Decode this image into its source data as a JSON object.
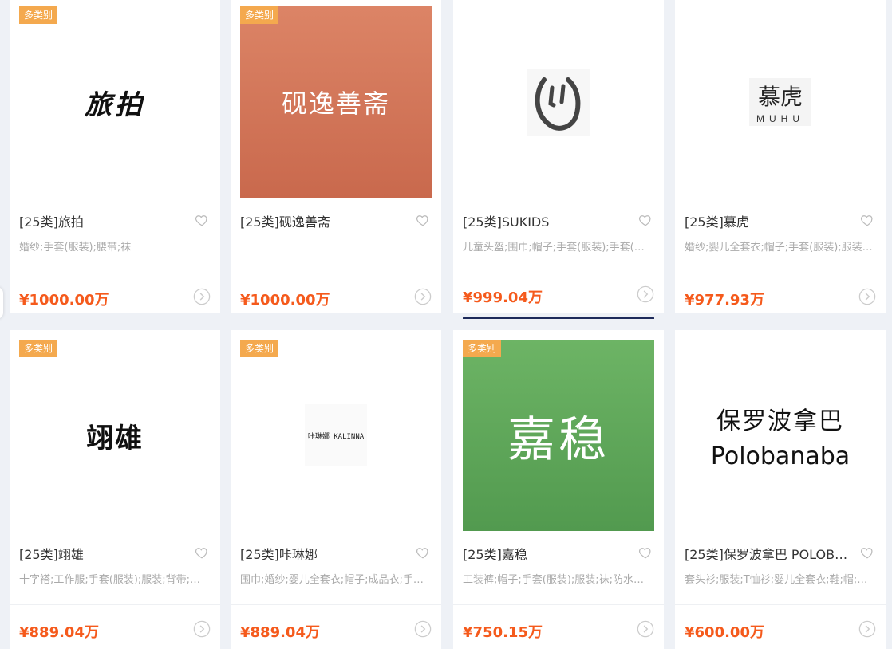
{
  "cards": [
    {
      "badge": "多类别",
      "logo_text": "旅拍",
      "title": "[25类]旅拍",
      "desc": "婚纱;手套(服装);腰带;袜",
      "price": "¥1000.00万"
    },
    {
      "badge": "多类别",
      "logo_text": "砚逸善斋",
      "title": "[25类]砚逸善斋",
      "desc": "",
      "price": "¥1000.00万",
      "logo_bg": "#d9745a"
    },
    {
      "badge": "",
      "logo_text": "",
      "title": "[25类]SUKIDS",
      "desc": "儿童头盔;围巾;帽子;手套(服装);手套(…",
      "price": "¥999.04万"
    },
    {
      "badge": "",
      "logo_text": "慕虎",
      "logo_sub": "MUHU",
      "title": "[25类]慕虎",
      "desc": "婚纱;婴儿全套衣;帽子;手套(服装);服装…",
      "price": "¥977.93万"
    },
    {
      "badge": "多类别",
      "logo_text": "翊雄",
      "title": "[25类]翊雄",
      "desc": "十字褡;工作服;手套(服装);服装;背带;…",
      "price": "¥889.04万"
    },
    {
      "badge": "多类别",
      "logo_text": "咔琳娜 KALINNA",
      "title": "[25类]咔琳娜",
      "desc": "围巾;婚纱;婴儿全套衣;帽子;成品衣;手…",
      "price": "¥889.04万"
    },
    {
      "badge": "多类别",
      "logo_text": "嘉稳",
      "title": "[25类]嘉稳",
      "desc": "工装裤;帽子;手套(服装);服装;袜;防水…",
      "price": "¥750.15万",
      "logo_bg": "#5fa85a"
    },
    {
      "badge": "",
      "logo_text": "保罗波拿巴",
      "logo_sub": "Polobanaba",
      "title": "[25类]保罗波拿巴 POLOB…",
      "desc": "套头衫;服装;T恤衫;婴儿全套衣;鞋;帽;…",
      "price": "¥600.00万"
    }
  ],
  "icons": {
    "favorite": "heart-icon",
    "detail": "chevron-circle-icon"
  }
}
